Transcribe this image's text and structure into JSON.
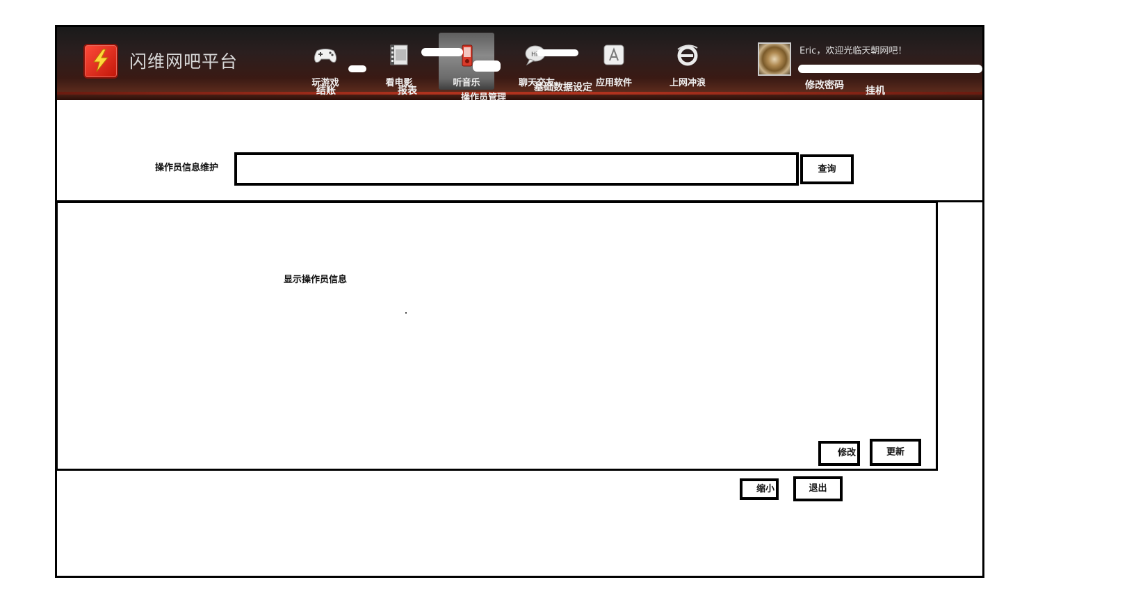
{
  "app": {
    "title": "闪维网吧平台",
    "logo_icon": "lightning-icon"
  },
  "nav": {
    "items": [
      {
        "label": "玩游戏",
        "icon": "gamepad-icon"
      },
      {
        "label": "看电影",
        "icon": "film-icon"
      },
      {
        "label": "听音乐",
        "icon": "music-icon",
        "active": true
      },
      {
        "label": "聊天交友",
        "icon": "chat-icon"
      },
      {
        "label": "应用软件",
        "icon": "app-store-icon"
      },
      {
        "label": "上网冲浪",
        "icon": "ie-browser-icon"
      }
    ],
    "sub_labels": {
      "checkout": "结账",
      "report": "报表",
      "operator_manage": "操作员管理",
      "basic_data": "基础数据设定",
      "change_password": "修改密码",
      "hang_up": "挂机"
    }
  },
  "user": {
    "welcome": "Eric，欢迎光临天朝网吧！",
    "avatar_icon": "avatar-coffee-icon"
  },
  "search": {
    "label": "操作员信息维护",
    "value": "",
    "placeholder": "",
    "query_button": "查询"
  },
  "main": {
    "display_label": "显示操作员信息",
    "modify_button": "修改",
    "update_button": "更新"
  },
  "footer": {
    "minimize_button": "缩小",
    "exit_button": "退出"
  },
  "colors": {
    "header_dark": "#1a1a1a",
    "header_red_band": "#b0321e",
    "logo_red": "#e52a1a",
    "border": "#000000"
  }
}
